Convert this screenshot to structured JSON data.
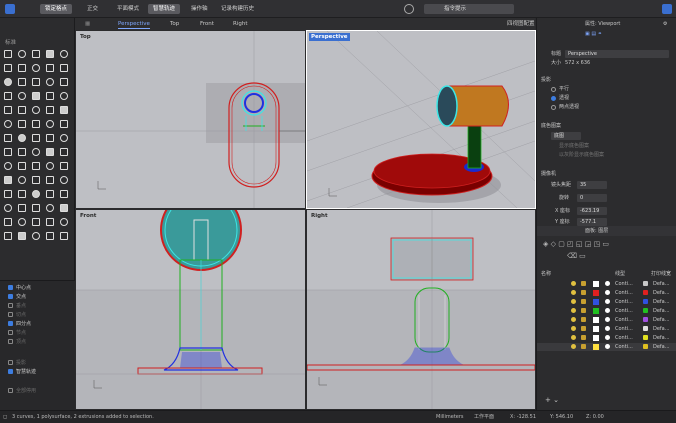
{
  "toolbar": {
    "buttons": [
      "锁定格点",
      "正交",
      "平面模式",
      "智慧轨迹",
      "操作轴",
      "记录构建历史"
    ],
    "active_index": 0,
    "active_index2": 3,
    "command_label": "指令提示"
  },
  "viewport_tabs": {
    "tabs": [
      "Perspective",
      "Top",
      "Front",
      "Right"
    ],
    "active": 0,
    "layout_label": "四视图配置"
  },
  "left_panel": {
    "title": "标准",
    "osnap": [
      {
        "label": "中心点",
        "checked": true
      },
      {
        "label": "交点",
        "checked": true
      },
      {
        "label": "垂点",
        "checked": false
      },
      {
        "label": "切点",
        "checked": false
      },
      {
        "label": "四分点",
        "checked": true
      },
      {
        "label": "节点",
        "checked": false
      },
      {
        "label": "顶点",
        "checked": false
      },
      {
        "label": "投影",
        "checked": false
      },
      {
        "label": "智慧轨迹",
        "checked": true
      },
      {
        "label": "全部停用",
        "checked": false
      }
    ]
  },
  "viewports": {
    "top": {
      "title": "Top"
    },
    "perspective": {
      "title": "Perspective"
    },
    "front": {
      "title": "Front"
    },
    "right": {
      "title": "Right"
    }
  },
  "properties": {
    "panel_title": "属性: Viewport",
    "title_label": "标题",
    "title_value": "Perspective",
    "size_label": "大小",
    "size_value": "572 x 636",
    "projection_label": "投影",
    "projection_options": [
      "平行",
      "透视",
      "两点透视"
    ],
    "projection_selected": 1,
    "display_label": "底色图案",
    "display_value": "底图",
    "opt1": "显示底色图案",
    "opt2": "以灰阶显示底色图案",
    "camera_label": "摄像机",
    "lens_label": "镜头焦距",
    "lens_value": "35",
    "rotation_label": "旋转",
    "rotation_value": "0",
    "x_label": "X 座标",
    "x_value": "-623.19",
    "y_label": "Y 座标",
    "y_value": "-577.1"
  },
  "layers_panel": {
    "title": "面板: 图层",
    "col_name": "名称",
    "col_linetype": "线型",
    "col_print": "打印线宽",
    "rows": [
      {
        "color": "#ffffff",
        "linetype": "Conti...",
        "print": "Defa...",
        "dot": "#c8c8c8"
      },
      {
        "color": "#e02020",
        "linetype": "Conti...",
        "print": "Defa...",
        "dot": "#e02020"
      },
      {
        "color": "#3050e0",
        "linetype": "Conti...",
        "print": "Defa...",
        "dot": "#3050e0"
      },
      {
        "color": "#20c020",
        "linetype": "Conti...",
        "print": "Defa...",
        "dot": "#20c020"
      },
      {
        "color": "#ffffff",
        "linetype": "Conti...",
        "print": "Defa...",
        "dot": "#a050e0"
      },
      {
        "color": "#ffffff",
        "linetype": "Conti...",
        "print": "Defa...",
        "dot": "#e0e0e0"
      },
      {
        "color": "#ffffff",
        "linetype": "Conti...",
        "print": "Defa...",
        "dot": "#e0e020"
      },
      {
        "color": "#ffe040",
        "linetype": "Conti...",
        "print": "Defa...",
        "dot": "#e0c020"
      }
    ]
  },
  "status": {
    "message": "3 curves, 1 polysurface, 2 extrusions added to selection.",
    "units": "Millimeters",
    "cplane": "工作平面",
    "x": "X: -128.51",
    "y": "Y: 546.10",
    "z": "Z: 0.00"
  },
  "colors": {
    "viewport_bg": "#bebfc4",
    "accent": "#3a6fd0",
    "cyan": "#3ce6e6",
    "red": "#d02020",
    "green": "#20b020",
    "blue": "#2030e0"
  }
}
